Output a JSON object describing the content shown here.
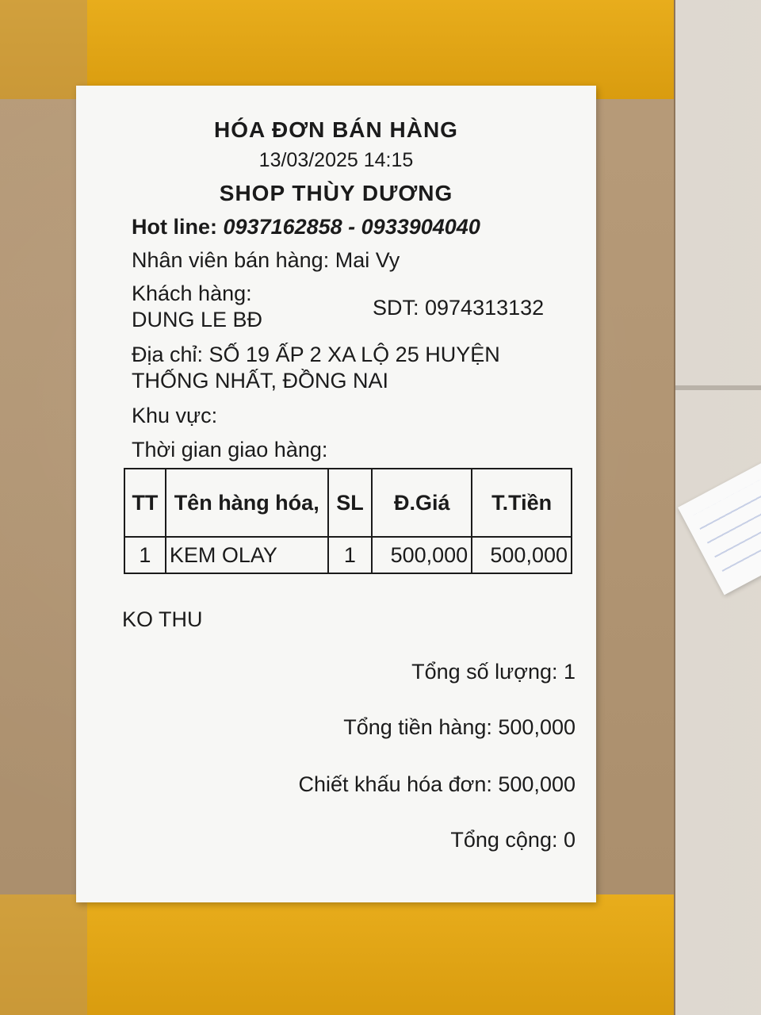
{
  "receipt": {
    "title": "HÓA ĐƠN BÁN HÀNG",
    "datetime": "13/03/2025 14:15",
    "shop_name": "SHOP THÙY DƯƠNG",
    "hotline_label": "Hot line:",
    "hotline_numbers": "0937162858 - 0933904040",
    "staff": "Nhân viên bán hàng: Mai Vy",
    "customer_label": "Khách hàng:",
    "customer_name": "DUNG LE BĐ",
    "phone": "SDT: 0974313132",
    "address_line1": "Địa chỉ: SỐ 19 ẤP 2 XA LỘ 25 HUYỆN",
    "address_line2": "THỐNG NHẤT, ĐỒNG NAI",
    "area": "Khu vực:",
    "delivery_time": "Thời gian giao hàng:",
    "table": {
      "headers": [
        "TT",
        "Tên hàng hóa,",
        "SL",
        "Đ.Giá",
        "T.Tiền"
      ],
      "rows": [
        [
          "1",
          "KEM OLAY",
          "1",
          "500,000",
          "500,000"
        ]
      ]
    },
    "note": "KO THU",
    "total_qty": "Tổng số lượng: 1",
    "subtotal": "Tổng tiền hàng: 500,000",
    "discount": "Chiết khấu hóa đơn: 500,000",
    "grand_total": "Tổng cộng: 0"
  },
  "colors": {
    "tape": "#e3a617",
    "cardboard": "#b69a78",
    "paper": "#f7f7f5",
    "ink": "#1b1b1b"
  }
}
